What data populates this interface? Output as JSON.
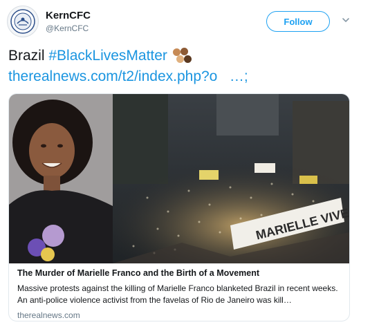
{
  "author": {
    "name": "KernCFC",
    "handle": "@KernCFC",
    "avatar_icon": "kerncfc-seal-logo"
  },
  "actions": {
    "follow_label": "Follow",
    "caret_icon": "chevron-down-icon"
  },
  "tweet": {
    "text_word": "Brazil",
    "hashtag": "#BlackLivesMatter",
    "emoji_icon": "raised-hands-emoji-icon",
    "link": "therealnews.com/t2/index.php?o",
    "trailing": "…;"
  },
  "card": {
    "image_description_icon": "article-photo",
    "banner_text": "MARIELLE VIVE",
    "title": "The Murder of Marielle Franco and the Birth of a Movement",
    "description": "Massive protests against the killing of Marielle Franco blanketed Brazil in recent weeks. An anti-police violence activist from the favelas of Rio de Janeiro was kill…",
    "domain": "therealnews.com"
  },
  "colors": {
    "link": "#1b95e0",
    "follow": "#1da1f2",
    "muted": "#657786"
  }
}
